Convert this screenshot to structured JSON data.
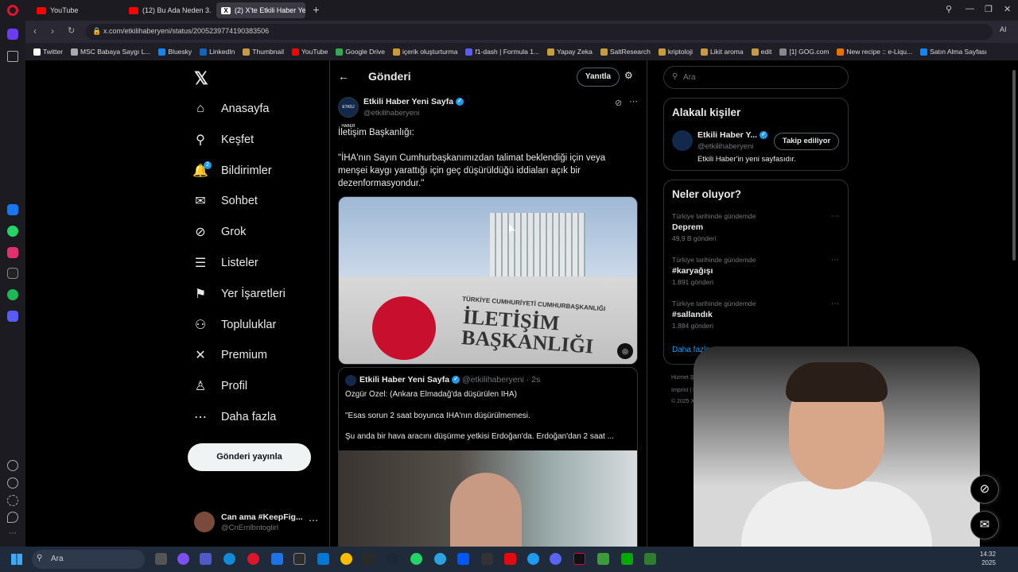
{
  "browser": {
    "tabs": [
      {
        "label": "YouTube",
        "active": false
      },
      {
        "label": "(12) Bu Ada Neden 3. Dün",
        "active": false
      },
      {
        "label": "(2) X'te Etkili Haber Yeni S",
        "active": true
      }
    ],
    "url": "x.com/etkilihaberyeni/status/2005239774190383506",
    "bookmarks": [
      "Twitter",
      "MSC Babaya Saygı L...",
      "Bluesky",
      "LinkedIn",
      "Thumbnail",
      "YouTube",
      "Google Drive",
      "içerik oluşturturma",
      "f1-dash | Formula 1...",
      "Yapay Zeka",
      "SaltResearch",
      "kriptoloji",
      "Likit aroma",
      "edit",
      "[1] GOG.com",
      "New recipe :: e-Liqu...",
      "Satın Alma Sayfası"
    ],
    "ai_label": "AI"
  },
  "nav": {
    "items": [
      {
        "label": "Anasayfa",
        "icon": "home-icon",
        "glyph": "⌂"
      },
      {
        "label": "Keşfet",
        "icon": "search-icon",
        "glyph": "⚲"
      },
      {
        "label": "Bildirimler",
        "icon": "bell-icon",
        "glyph": "🔔"
      },
      {
        "label": "Sohbet",
        "icon": "mail-icon",
        "glyph": "✉"
      },
      {
        "label": "Grok",
        "icon": "grok-icon",
        "glyph": "⊘"
      },
      {
        "label": "Listeler",
        "icon": "list-icon",
        "glyph": "☰"
      },
      {
        "label": "Yer İşaretleri",
        "icon": "bookmark-icon",
        "glyph": "⚑"
      },
      {
        "label": "Topluluklar",
        "icon": "communities-icon",
        "glyph": "⚇"
      },
      {
        "label": "Premium",
        "icon": "x-icon",
        "glyph": "✕"
      },
      {
        "label": "Profil",
        "icon": "profile-icon",
        "glyph": "♙"
      },
      {
        "label": "Daha fazla",
        "icon": "more-icon",
        "glyph": "⋯"
      }
    ],
    "notif_badge": "2",
    "post_button": "Gönderi yayınla",
    "profile": {
      "name": "Can ama #KeepFig...",
      "handle": "@CnErnlbntoglirl"
    }
  },
  "main": {
    "title": "Gönderi",
    "reply_button": "Yanıtla",
    "post": {
      "author": "Etkili Haber Yeni Sayfa",
      "handle": "@etkilihaberyeni",
      "avatar_text": "ETKİLİ HABER",
      "line1": "İletişim Başkanlığı:",
      "line2": "\"İHA'nın Sayın Cumhurbaşkanımızdan talimat beklendiği için veya menşei kaygı yarattığı için geç düşürüldüğü iddiaları açık bir dezenformasyondur.\"",
      "image_sign_small": "TÜRKİYE CUMHURİYETİ CUMHURBAŞKANLIĞI",
      "image_sign_big": "İLETİŞİM BAŞKANLIĞI"
    },
    "quote": {
      "author": "Etkili Haber Yeni Sayfa",
      "handle": "@etkilihaberyeni · 2s",
      "line1": "Özgür Özel: (Ankara Elmadağ'da düşürülen İHA)",
      "line2": "\"Esas sorun 2 saat boyunca İHA'nın düşürülmemesi.",
      "line3": "Şu anda bir hava aracını düşürme yetkisi Erdoğan'da. Erdoğan'dan 2 saat ..."
    }
  },
  "right": {
    "search_placeholder": "Ara",
    "related": {
      "title": "Alakalı kişiler",
      "name": "Etkili Haber Y...",
      "handle": "@etkilihaberyeni",
      "follow_label": "Takip ediliyor",
      "bio": "Etkili Haber'in yeni sayfasıdır."
    },
    "trends": {
      "title": "Neler oluyor?",
      "items": [
        {
          "context": "Türkiye tarihinde gündemde",
          "name": "Deprem",
          "count": "49,9 B gönderi"
        },
        {
          "context": "Türkiye tarihinde gündemde",
          "name": "#karyağışı",
          "count": "1.891 gönderi"
        },
        {
          "context": "Türkiye tarihinde gündemde",
          "name": "#sallandık",
          "count": "1.884 gönderi"
        }
      ],
      "show_more": "Daha fazla göster"
    },
    "footer": {
      "line1": "Hizmet Şartları  |  Gizlilik Politikası  |  Çerez",
      "line2": "Imprint  |  Erişilebilirlik  |  Reklam bilgisi",
      "line3": "© 2025 X Corp."
    }
  },
  "taskbar": {
    "search_placeholder": "Ara",
    "time": "14:32",
    "year": "2025"
  }
}
